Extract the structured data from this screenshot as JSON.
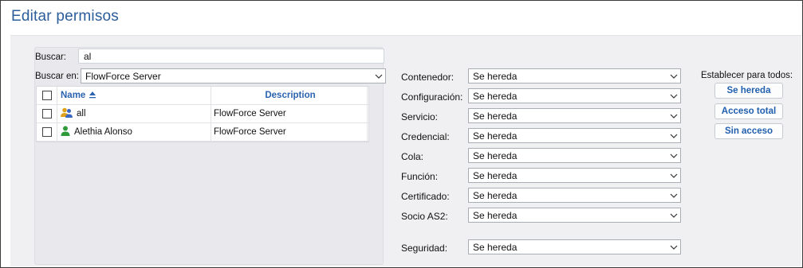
{
  "page": {
    "title": "Editar permisos"
  },
  "search": {
    "label": "Buscar:",
    "value": "al",
    "in_label": "Buscar en:",
    "in_value": "FlowForce Server"
  },
  "grid": {
    "col_name": "Name",
    "col_desc": "Description",
    "rows": [
      {
        "name": "all",
        "desc": "FlowForce Server",
        "icon": "group-icon"
      },
      {
        "name": "Alethia Alonso",
        "desc": "FlowForce Server",
        "icon": "user-icon"
      }
    ]
  },
  "permissions": [
    {
      "label": "Contenedor:",
      "value": "Se hereda"
    },
    {
      "label": "Configuración:",
      "value": "Se hereda"
    },
    {
      "label": "Servicio:",
      "value": "Se hereda"
    },
    {
      "label": "Credencial:",
      "value": "Se hereda"
    },
    {
      "label": "Cola:",
      "value": "Se hereda"
    },
    {
      "label": "Función:",
      "value": "Se hereda"
    },
    {
      "label": "Certificado:",
      "value": "Se hereda"
    },
    {
      "label": "Socio AS2:",
      "value": "Se hereda"
    },
    {
      "label": "Seguridad:",
      "value": "Se hereda"
    }
  ],
  "set_all": {
    "label": "Establecer para todos:",
    "buttons": [
      "Se hereda",
      "Acceso total",
      "Sin acceso"
    ]
  },
  "colors": {
    "title": "#2a5d9a",
    "link": "#2b63b0",
    "group_icon": "#e0a21a",
    "user_icon": "#2f9a3a"
  }
}
